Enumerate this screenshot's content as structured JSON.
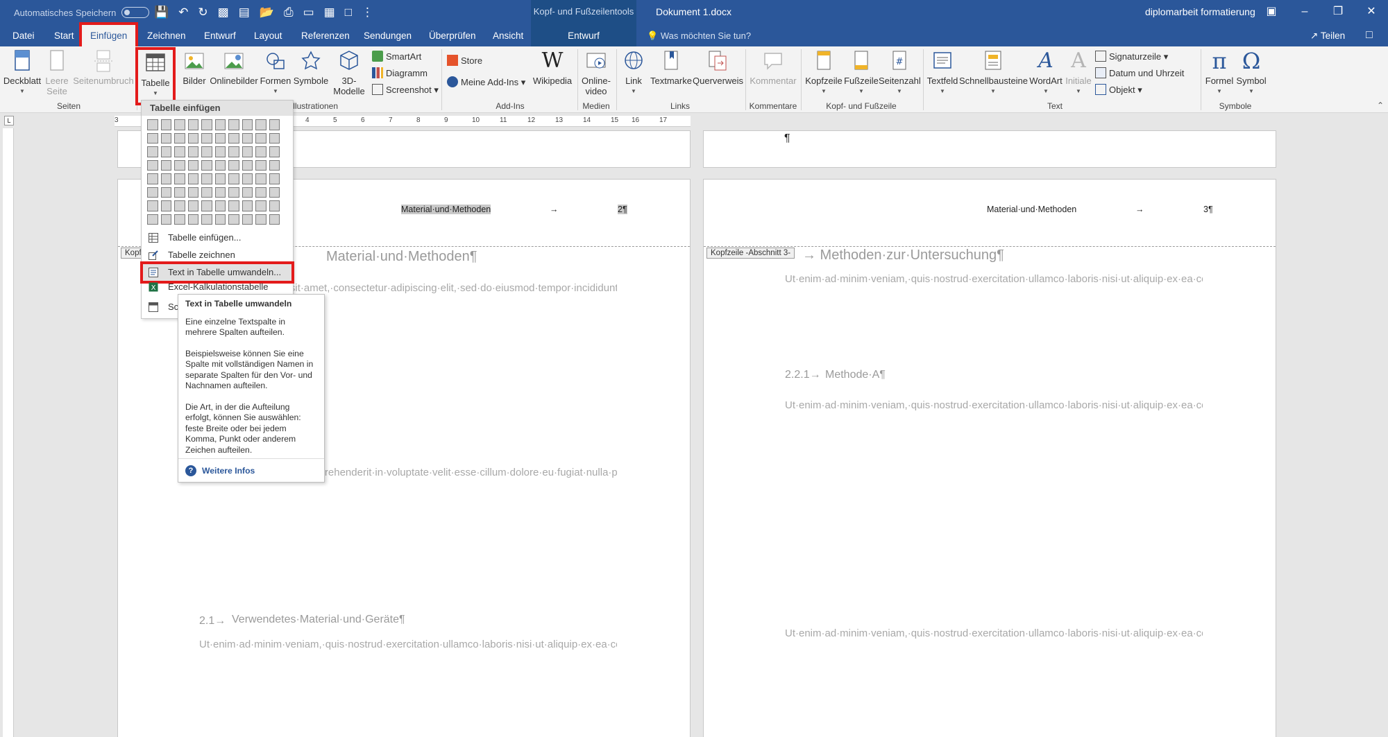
{
  "titlebar": {
    "autosave_label": "Automatisches Speichern",
    "context_group": "Kopf- und Fußzeilentools",
    "context_tab": "Entwurf",
    "doc_title": "Dokument 1.docx",
    "file_name": "diplomarbeit formatierung",
    "share": "Teilen",
    "tellme": "Was möchten Sie tun?"
  },
  "tabs": [
    "Datei",
    "Start",
    "Einfügen",
    "Zeichnen",
    "Entwurf",
    "Layout",
    "Referenzen",
    "Sendungen",
    "Überprüfen",
    "Ansicht"
  ],
  "ribbon": {
    "deckblatt": "Deckblatt",
    "leere_seite": "Leere Seite",
    "seitenumbruch": "Seitenumbruch",
    "tabelle": "Tabelle",
    "bilder": "Bilder",
    "onlinebilder": "Onlinebilder",
    "formen": "Formen",
    "symbole": "Symbole",
    "modelle_3d": "3D-",
    "modelle_3d_2": "Modelle",
    "smartart": "SmartArt",
    "diagramm": "Diagramm",
    "screenshot": "Screenshot",
    "store": "Store",
    "meine_addins": "Meine Add-Ins",
    "wikipedia": "Wikipedia",
    "onlinevideo": "Online-",
    "onlinevideo_2": "video",
    "link": "Link",
    "textmarke": "Textmarke",
    "querverweis": "Querverweis",
    "kommentar": "Kommentar",
    "kopfzeile": "Kopfzeile",
    "fusszeile": "Fußzeile",
    "seitenzahl": "Seitenzahl",
    "textfeld": "Textfeld",
    "schnellbausteine": "Schnellbausteine",
    "wordart": "WordArt",
    "initiale": "Initiale",
    "signaturzeile": "Signaturzeile",
    "datum_uhrzeit": "Datum und Uhrzeit",
    "objekt": "Objekt",
    "formel": "Formel",
    "symbol": "Symbol",
    "groups": {
      "seiten": "Seiten",
      "illustrationen": "Illustrationen",
      "addins": "Add-Ins",
      "medien": "Medien",
      "links": "Links",
      "kommentare": "Kommentare",
      "kopf_fuss": "Kopf- und Fußzeile",
      "text": "Text",
      "symbole": "Symbole"
    }
  },
  "ruler": [
    "3",
    "4",
    "5",
    "6",
    "7",
    "8",
    "9",
    "10",
    "11",
    "12",
    "13",
    "14",
    "15",
    "16",
    "17"
  ],
  "dropdown": {
    "title": "Tabelle einfügen",
    "items": [
      "Tabelle einfügen...",
      "Tabelle zeichnen",
      "Text in Tabelle umwandeln...",
      "Excel-Kalkulationstabelle",
      "Schnelltabellen"
    ]
  },
  "tooltip": {
    "title": "Text in Tabelle umwandeln",
    "p1": "Eine einzelne Textspalte in mehrere Spalten aufteilen.",
    "p2": "Beispielsweise können Sie eine Spalte mit vollständigen Namen in separate Spalten für den Vor- und Nachnamen aufteilen.",
    "p3": "Die Art, in der die Aufteilung erfolgt, können Sie auswählen: feste Breite oder bei jedem Komma, Punkt oder anderem Zeichen aufteilen.",
    "more": "Weitere Infos"
  },
  "page_left": {
    "top_mark": "",
    "header_text": "Material·und·Methoden",
    "header_arrow": "→",
    "header_num": "2¶",
    "header_label": "Kopfzeile -Abschnitt 2-",
    "heading": "Material·und·Methoden¶",
    "p1": "Lorem·ipsum·dolor·sit·amet,·consectetur·adipiscing·elit,·sed·do·eiusmod·tempor·incididunt·ut·labore·et·dolore·magna·aliqua.·Ut·enim·ad·minim·veniam,·quis·nostrud·exercitation·ullamco·laboris·nisi·ut·aliquip·ex·ea·commodo·consequat.·Duis·aute·irure·dolor·in·reprehenderit·in·voluptate·velit·esse·cillum·dolore·eu·fugiat·nulla·pariatur.·Excepteur·sint·occaecat·cupidatat·non·proident,·sunt·in·culpa·qui·officia·deserunt·mollit·anim·id·est·laborum.·Lorem·ipsum·dolor·sit·amet,·consectetur·adipiscing·elit,·sed·do·eiusmod·tempor·incididunt·ut·labore·et·dolore·magna·aliqua.·Ut·enim·ad·minim·veniam,·quis·nostrud·exercitation·ullamco·laboris·nisi·ut·aliquip·ex·ea·commodo·consequat.·¶",
    "p2": "Duis·aute·irure·dolor·in·reprehenderit·in·voluptate·velit·esse·cillum·dolore·eu·fugiat·nulla·pariatur.·Excepteur·sint·occaecat·cupidatat·non·proident,·sunt·in·culpa·qui·officia·deserunt·mollit·anim·id·est·laborum.·Lorem·ipsum·dolor·sit·amet,·consectetur·adipiscing·elit,·sed·do·eiusmod·tempor·incididunt·ut·labore·et·dolore·magna·aliqua.·Ut·enim·ad·minim·veniam,·quis·nostrud·exercitation·ullamco·laboris·nisi·ut·aliquip·ex·ea·commodo·consequat.·¶",
    "sub_num": "2.1→",
    "sub_title": "Verwendetes·Material·und·Geräte¶",
    "p3": "Ut·enim·ad·minim·veniam,·quis·nostrud·exercitation·ullamco·laboris·nisi·ut·aliquip·ex·ea·commodo·consequat.·Duis·aute·irure·dolor·in·reprehenderit·in·voluptate·velit·esse·cillum·dolore·eu·fugiat·nulla·pariatur.·Excepteur·sint·occaecat·cupidatat·non·proident,·sunt·in·culpa·qui·officia·deserunt·mollit·anim·id·est·laborum.·Lorem·ipsum·dolor·sit·amet,·consectetur·adipiscing·elit,·sed·do·eiusmod·tempor·incididunt·ut·labore·et"
  },
  "page_right": {
    "top_mark": "¶",
    "header_text": "Material·und·Methoden",
    "header_arrow": "→",
    "header_num": "3¶",
    "header_label": "Kopfzeile -Abschnitt 3-",
    "heading": "→ Methoden·zur·Untersuchung¶",
    "p1": "Ut·enim·ad·minim·veniam,·quis·nostrud·exercitation·ullamco·laboris·nisi·ut·aliquip·ex·ea·commodo·consequat.·Duis·aute·irure·dolor·in·reprehenderit·in·voluptate·velit·esse·cillum·dolore·eu·fugiat·nulla·pariatur.·Excepteur·sint·occaecat·cupidatat·non·proident,·sunt·in·culpa·qui·officia·deserunt·mollit·anim·id·est·laborum.·¶",
    "sub_num": "2.2.1→",
    "sub_title": "Methode·A¶",
    "p2": "Ut·enim·ad·minim·veniam,·quis·nostrud·exercitation·ullamco·laboris·nisi·ut·aliquip·ex·ea·commodo·consequat.·Duis·aute·irure·dolor·in·reprehenderit·in·voluptate·velit·esse·cillum·dolore·eu·fugiat·nulla·pariatur.·Excepteur·sint·occaecat·cupidatat·non·proident,·sunt·in·culpa·qui·officia·deserunt·mollit·anim·id·est·laborum.·Lorem·ipsum·dolor·sit·amet,·consectetur·adipiscing·elit,·sed·do·eiusmod·tempor·incididunt·ut·labore·et·dolore·magna·aliqua.·Ut·enim·ad·minim·veniam,·quis·nostrud·exercitation·ullamco·laboris·nisi·ut·aliquip·ex·ea·commodo·consequat.·Duis·aute·irure·dolor·in·reprehenderit·in·voluptate·velit·esse·cillum·dolore·eu·fugiat·nulla·pariatur.·Excepteur·sint·occaecat·cupidatat·non·proident,·sunt·in·culpa·qui·officia·deserunt·mollit·anim·id·est·laborum.·Lorem·ipsum·dolor·sit·amet,·consectetur·adipiscing·elit,·sed·do·eiusmod·tempor·incididunt·ut·labore·et·dolore·magna·aliqua.·¶",
    "p3": "Ut·enim·ad·minim·veniam,·quis·nostrud·exercitation·ullamco·laboris·nisi·ut·aliquip·ex·ea·commodo·consequat.·Duis·aute·irure·dolor·in·reprehenderit·in·voluptate·velit·esse·cillum·dolore·eu·fugiat·nulla·pariatur.·Excepteur·sint·occaecat·cupidatat·non·proident,·sunt·in·culpa·qui·officia·deserunt·mollit·anim·id·est·laborum.·Lorem·ipsum·dolor·sit·amet,·consectetur·adipiscing·elit,·sed·do·eiusmod·tempor·incididunt·ut·labore·et·dolore·magna·aliqua.·Ut·enim·ad·minim·veniam,·quis·nostrud·exercitation·ullamco"
  },
  "colors": {
    "brand": "#2b579a",
    "highlight": "#e31b1b"
  }
}
